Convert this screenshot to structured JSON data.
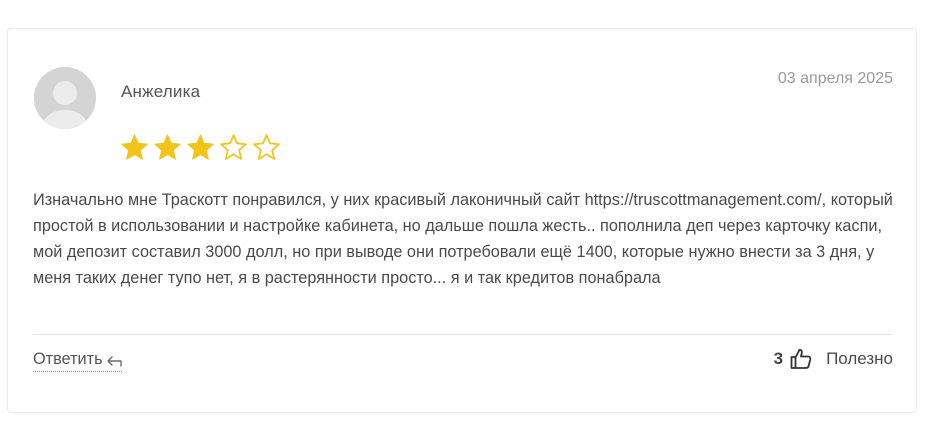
{
  "review": {
    "author": "Анжелика",
    "date": "03 апреля 2025",
    "rating": 3,
    "rating_max": 5,
    "text": "Изначально мне Трaскотт понравился, у них красивый лаконичный сайт https://truscottmanagement.com/, который простой в использовании и настройке кабинета, но дальше пошла жесть.. пополнила деп через карточку каспи, мой депозит составил 3000 долл, но при выводе они потребовали ещё 1400, которые нужно внести за 3 дня, у меня таких денег тупо нет, я в растерянности просто... я и так кредитов понабрала"
  },
  "actions": {
    "reply_label": "Ответить",
    "helpful_count": "3",
    "helpful_label": "Полезно"
  },
  "colors": {
    "star_filled": "#F2C318",
    "star_empty_outline": "#F2C318",
    "avatar_bg": "#D6D6D6",
    "text": "#4A4A4A",
    "muted": "#9A9A9A"
  },
  "icons": {
    "avatar": "user-placeholder-icon",
    "star": "star-icon",
    "reply": "reply-arrow-icon",
    "helpful": "thumbs-up-icon"
  }
}
